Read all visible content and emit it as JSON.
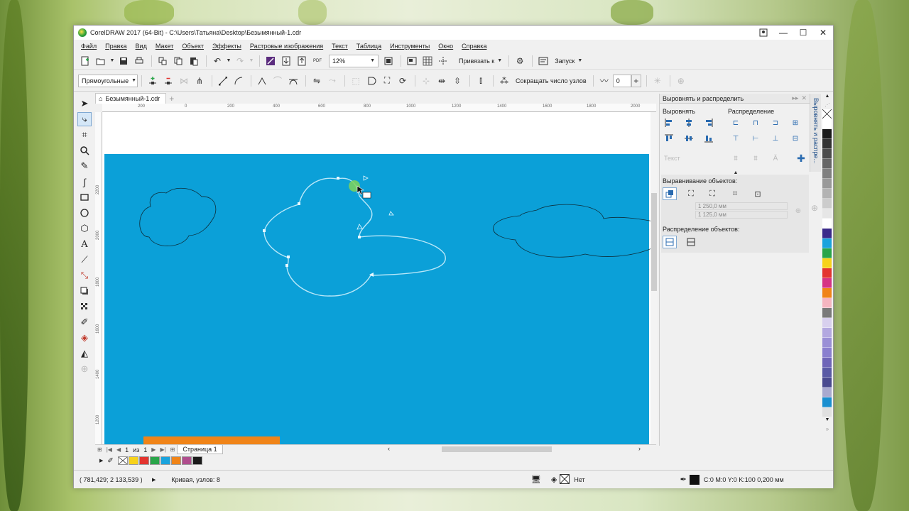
{
  "window": {
    "title": "CorelDRAW 2017 (64-Bit) - C:\\Users\\Татьяна\\Desktop\\Безымянный-1.cdr"
  },
  "menu": [
    "Файл",
    "Правка",
    "Вид",
    "Макет",
    "Объект",
    "Эффекты",
    "Растровые изображения",
    "Текст",
    "Таблица",
    "Инструменты",
    "Окно",
    "Справка"
  ],
  "toolbar1": {
    "zoom_value": "12%",
    "snap_label": "Привязать к",
    "launch_label": "Запуск"
  },
  "toolbar2": {
    "shape_mode": "Прямоугольные",
    "reduce_nodes_label": "Сокращать число узлов",
    "smoothness_value": "0"
  },
  "doc_tab": {
    "label": "Безымянный-1.cdr"
  },
  "ruler": {
    "h_ticks": [
      "200",
      "0",
      "200",
      "400",
      "600",
      "800",
      "1000",
      "1200",
      "1400",
      "1600",
      "1800",
      "2000"
    ],
    "v_ticks": [
      "2200",
      "2000",
      "1800",
      "1600",
      "1400",
      "1200"
    ]
  },
  "navigation": {
    "current_page": "1",
    "of_label": "из",
    "total_pages": "1",
    "page_tab": "Страница 1"
  },
  "docker": {
    "title": "Выровнять и распределить",
    "align_label": "Выровнять",
    "distribute_label": "Распределение",
    "text_label": "Текст",
    "align_objects_label": "Выравнивание объектов:",
    "x_value": "1 250,0 мм",
    "y_value": "1 125,0 мм",
    "distribute_objects_label": "Распределение объектов:",
    "side_tab_label": "Выровнять и распре..."
  },
  "status": {
    "coordinates": "( 781,429; 2 133,539 )",
    "object_info": "Кривая, узлов: 8",
    "fill_label": "Нет",
    "outline_info": "C:0 M:0 Y:0 K:100  0,200 мм"
  },
  "colors": {
    "canvas_bg": "#0ba0d8",
    "orange_bar": "#f08418",
    "palette_row": [
      "#ffffff",
      "#f7d21a",
      "#e3342f",
      "#2aa54a",
      "#1aa3dd",
      "#f08418",
      "#b04d8e",
      "#1a1a1a"
    ],
    "palette_column": [
      "#ffffff",
      "#1a1a1a",
      "#333333",
      "#4d4d4d",
      "#666666",
      "#808080",
      "#999999",
      "#b3b3b3",
      "#cccccc",
      "#e6e6e6",
      "#ffffff",
      "#3b2a8a",
      "#1aa3dd",
      "#2aa54a",
      "#f7d21a",
      "#e3342f",
      "#d63384",
      "#f08418",
      "#f5b5c0",
      "#7a7a7a",
      "#d8d0ee",
      "#b3a8e0",
      "#9a8fd6",
      "#8a7fcf",
      "#6f65b8",
      "#5a5aa5",
      "#4a4a8f",
      "#a9a9cf",
      "#1a8fd0",
      "#e0e0e0"
    ]
  }
}
